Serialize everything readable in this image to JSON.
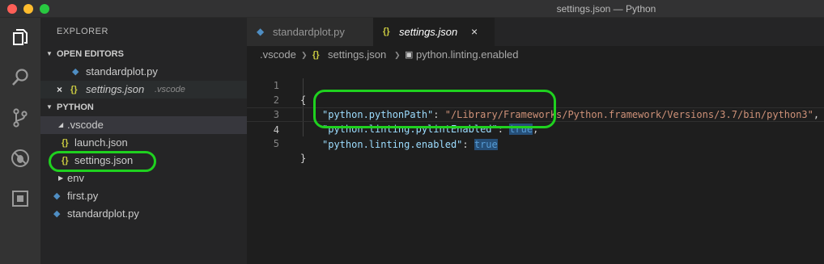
{
  "window": {
    "title": "settings.json — Python"
  },
  "sidebar": {
    "title": "EXPLORER",
    "open_editors_header": "OPEN EDITORS",
    "open_editors": [
      {
        "label": "standardplot.py"
      },
      {
        "label": "settings.json",
        "folder_hint": ".vscode"
      }
    ],
    "workspace_header": "PYTHON",
    "tree": [
      {
        "label": ".vscode"
      },
      {
        "label": "launch.json"
      },
      {
        "label": "settings.json"
      },
      {
        "label": "env"
      },
      {
        "label": "first.py"
      },
      {
        "label": "standardplot.py"
      }
    ]
  },
  "tabs": [
    {
      "label": "standardplot.py"
    },
    {
      "label": "settings.json",
      "close": "×"
    }
  ],
  "breadcrumb": {
    "folder": ".vscode",
    "file": "settings.json",
    "symbol": "python.linting.enabled"
  },
  "editor": {
    "line_numbers": [
      "1",
      "2",
      "3",
      "4",
      "5"
    ],
    "line1": "{",
    "line2_key": "\"python.pythonPath\"",
    "line2_value": "\"/Library/Frameworks/Python.framework/Versions/3.7/bin/python3\"",
    "line3_key": "\"python.linting.pylintEnabled\"",
    "line3_value": "true",
    "line4_key": "\"python.linting.enabled\"",
    "line4_value": "true",
    "line5": "}"
  },
  "icons": {
    "json": "{}",
    "python": "python-icon",
    "close": "×"
  },
  "colors": {
    "annotation": "#1fd11f",
    "json_icon": "#cbcb41",
    "python_icon": "#4f8ec3"
  }
}
